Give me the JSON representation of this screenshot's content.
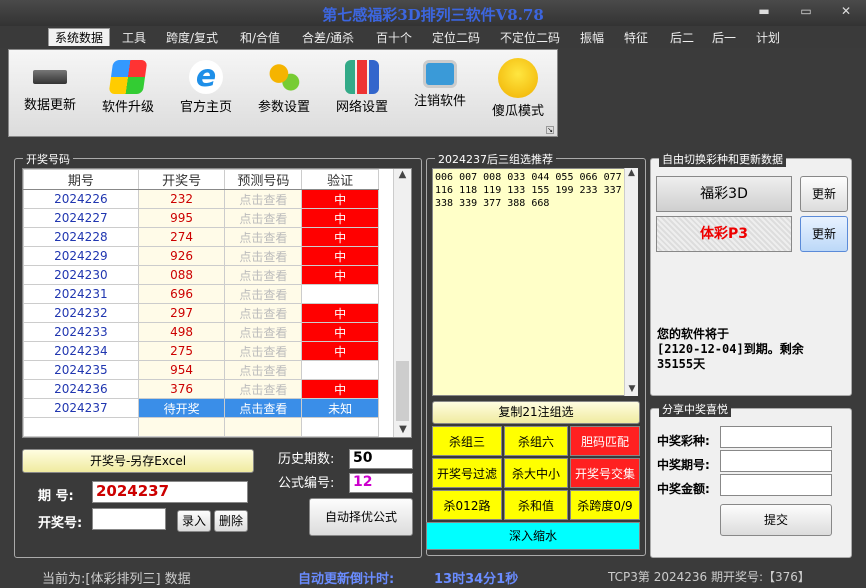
{
  "window": {
    "title": "第七感福彩3D排列三软件V8.78",
    "min": "▬",
    "max": "▭",
    "close": "✕"
  },
  "menu": [
    "系统数据",
    "工具",
    "跨度/复式",
    "和/合值",
    "合差/通杀",
    "百十个",
    "定位二码",
    "不定位二码",
    "振幅",
    "特征",
    "后二",
    "后一",
    "计划"
  ],
  "toolbar": {
    "buttons": [
      {
        "label": "数据更新",
        "icon": "chip-icon",
        "color": "#555"
      },
      {
        "label": "软件升级",
        "icon": "windows-logo-icon",
        "color": "#2a7de1"
      },
      {
        "label": "官方主页",
        "icon": "ie-browser-icon",
        "color": "#1e8fe8"
      },
      {
        "label": "参数设置",
        "icon": "gears-icon",
        "color": "#e8a010"
      },
      {
        "label": "网络设置",
        "icon": "bar-chart-icon",
        "color": "#d03030"
      },
      {
        "label": "注销软件",
        "icon": "monitor-icon",
        "color": "#3a9ad8"
      },
      {
        "label": "傻瓜模式",
        "icon": "smiley-icon",
        "color": "#f0c000"
      }
    ]
  },
  "draw_group": {
    "title": "开奖号码",
    "headers": [
      "期号",
      "开奖号",
      "预测号码",
      "验证"
    ],
    "rows": [
      {
        "issue": "2024226",
        "num": "232",
        "pred": "点击查看",
        "verify": "中",
        "hit": true
      },
      {
        "issue": "2024227",
        "num": "995",
        "pred": "点击查看",
        "verify": "中",
        "hit": true
      },
      {
        "issue": "2024228",
        "num": "274",
        "pred": "点击查看",
        "verify": "中",
        "hit": true
      },
      {
        "issue": "2024229",
        "num": "926",
        "pred": "点击查看",
        "verify": "中",
        "hit": true
      },
      {
        "issue": "2024230",
        "num": "088",
        "pred": "点击查看",
        "verify": "中",
        "hit": true
      },
      {
        "issue": "2024231",
        "num": "696",
        "pred": "点击查看",
        "verify": "",
        "hit": false
      },
      {
        "issue": "2024232",
        "num": "297",
        "pred": "点击查看",
        "verify": "中",
        "hit": true
      },
      {
        "issue": "2024233",
        "num": "498",
        "pred": "点击查看",
        "verify": "中",
        "hit": true
      },
      {
        "issue": "2024234",
        "num": "275",
        "pred": "点击查看",
        "verify": "中",
        "hit": true
      },
      {
        "issue": "2024235",
        "num": "954",
        "pred": "点击查看",
        "verify": "",
        "hit": false
      },
      {
        "issue": "2024236",
        "num": "376",
        "pred": "点击查看",
        "verify": "中",
        "hit": true
      }
    ],
    "current": {
      "issue": "2024237",
      "num": "待开奖",
      "pred": "点击查看",
      "verify": "未知"
    },
    "export_btn": "开奖号-另存Excel",
    "issue_label": "期  号:",
    "issue_value": "2024237",
    "drawnum_label": "开奖号:",
    "drawnum_value": "",
    "enter_btn": "录入",
    "delete_btn": "删除",
    "history_label": "历史期数:",
    "history_value": "50",
    "formula_label": "公式编号:",
    "formula_value": "12",
    "auto_btn": "自动择优公式"
  },
  "rec_group": {
    "title": "2024237后三组选推荐",
    "text": "006 007 008 033 044 055 066 077 116 118 119 133 155 199 233 337 338 339 377 388 668",
    "copy_btn": "复制21注组选",
    "buttons": [
      {
        "label": "杀组三",
        "style": "yellow"
      },
      {
        "label": "杀组六",
        "style": "yellow"
      },
      {
        "label": "胆码匹配",
        "style": "red"
      },
      {
        "label": "开奖号过滤",
        "style": "yellow"
      },
      {
        "label": "杀大中小",
        "style": "yellow"
      },
      {
        "label": "开奖号交集",
        "style": "red"
      },
      {
        "label": "杀012路",
        "style": "yellow"
      },
      {
        "label": "杀和值",
        "style": "yellow"
      },
      {
        "label": "杀跨度0/9",
        "style": "yellow"
      }
    ],
    "deep_btn": "深入缩水"
  },
  "switch_group": {
    "title": "自由切换彩种和更新数据",
    "fc3d": "福彩3D",
    "tcp3": "体彩P3",
    "update": "更新",
    "expire_line1": "您的软件将于",
    "expire_line2": "[2120-12-04]到期。剩余",
    "expire_line3": "35155天"
  },
  "share_group": {
    "title": "分享中奖喜悦",
    "lottery_label": "中奖彩种:",
    "issue_label": "中奖期号:",
    "amount_label": "中奖金额:",
    "submit": "提交"
  },
  "status": {
    "current": "当前为:[体彩排列三] 数据",
    "countdown_label": "自动更新倒计时:",
    "countdown_value": "13时34分1秒",
    "last_draw": "TCP3第 2024236 期开奖号:【376】"
  },
  "colors": {
    "hit": "#ff0000",
    "current_row": "#3a8ee8",
    "yellow_btn": "#ffff00",
    "cyan_btn": "#00ffff",
    "title_blue": "#3c66e0"
  }
}
